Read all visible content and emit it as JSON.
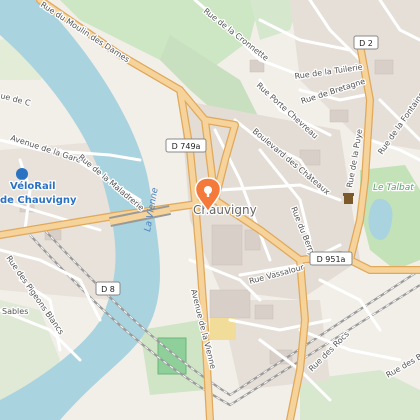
{
  "map": {
    "town": "Chauvigny",
    "river": "La Vienne",
    "poi": {
      "line1": "VéloRail",
      "line2": "de Chauvigny"
    },
    "park": "Le Talbat",
    "pin_icon": "map-pin-icon",
    "shields": {
      "d749a": "D 749a",
      "d2": "D 2",
      "d951a": "D 951a",
      "d8": "D 8"
    },
    "streets": {
      "moulin_des_dames": "Rue du Moulin des Dames",
      "cronnette": "Rue de la Cronnette",
      "tuilerie": "Rue de la Tuilerie",
      "porte_chevreau": "Rue Porte Chevreau",
      "bretagne": "Rue de Bretagne",
      "boulevard_chateaux": "Boulevard des Châteaux",
      "puye": "Rue de la Puye",
      "fontaine": "Rue de la Fontaine",
      "gare": "Avenue de la Gare",
      "maladrerie": "Rue de la Maladrerie",
      "berry": "Rue du Berry",
      "vassalour": "Rue Vassalour",
      "avenue_vienne": "Avenue de la Vienne",
      "pigeons_blancs": "Rue des Pigeons Blancs",
      "sables": "Sables",
      "rocs": "Rue des Rocs",
      "rue_des_b": "Rue des B",
      "ue_de_c": "ue de C"
    }
  }
}
